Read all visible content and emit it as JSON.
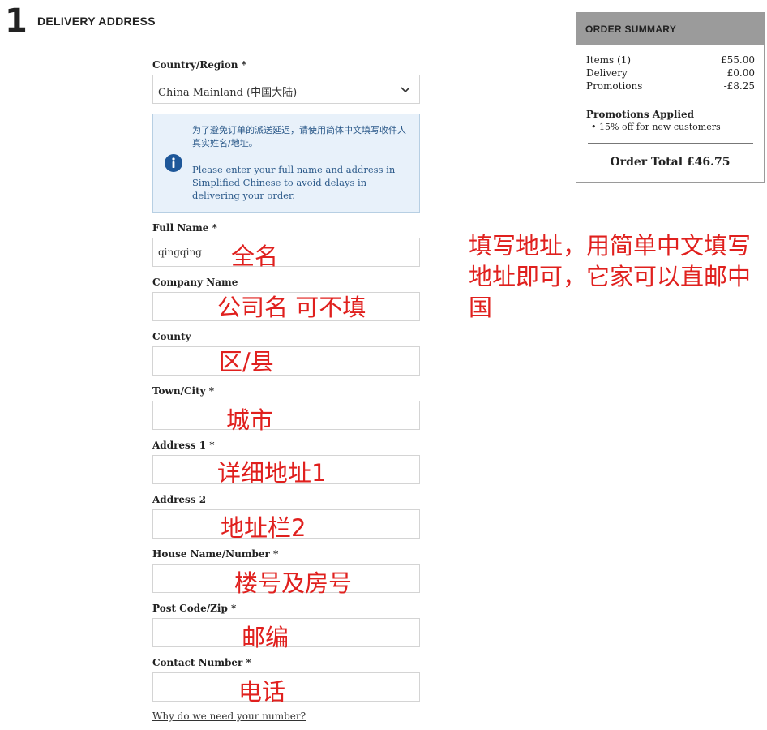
{
  "step": {
    "number": "1",
    "title": "DELIVERY ADDRESS"
  },
  "country": {
    "label": "Country/Region *",
    "value": "China Mainland (中国大陆)"
  },
  "notice": {
    "chinese": "为了避免订单的派送延迟，请使用简体中文填写收件人真实姓名/地址。",
    "english": "Please enter your full name and address in Simplified Chinese to avoid delays in delivering your order."
  },
  "fields": {
    "full_name": {
      "label": "Full Name *",
      "value": "qingqing"
    },
    "company": {
      "label": "Company Name",
      "value": ""
    },
    "county": {
      "label": "County",
      "value": ""
    },
    "town": {
      "label": "Town/City *",
      "value": ""
    },
    "address1": {
      "label": "Address 1 *",
      "value": ""
    },
    "address2": {
      "label": "Address 2",
      "value": ""
    },
    "house": {
      "label": "House Name/Number *",
      "value": ""
    },
    "postcode": {
      "label": "Post Code/Zip *",
      "value": ""
    },
    "contact": {
      "label": "Contact Number *",
      "value": ""
    }
  },
  "why_link": "Why do we need your number?",
  "annotations": {
    "full_name": "全名",
    "company": "公司名 可不填",
    "county": "区/县",
    "town": "城市",
    "address1": "详细地址1",
    "address2": "地址栏2",
    "house": "楼号及房号",
    "postcode": "邮编",
    "contact": "电话",
    "side_note": "填写地址，用简单中文填写地址即可，它家可以直邮中国"
  },
  "summary": {
    "title": "ORDER SUMMARY",
    "rows": [
      {
        "label": "Items (1)",
        "value": "£55.00"
      },
      {
        "label": "Delivery",
        "value": "£0.00"
      },
      {
        "label": "Promotions",
        "value": "-£8.25"
      }
    ],
    "promotions_title": "Promotions Applied",
    "promotion_item": "15% off for new customers",
    "total": "Order Total £46.75"
  },
  "colors": {
    "annotation": "#e0201e",
    "notice_bg": "#e8f1fa",
    "notice_text": "#2c5a8a",
    "summary_header": "#9b9b9b"
  },
  "icons": {
    "info": "info-icon",
    "dropdown": "chevron-down-icon"
  }
}
